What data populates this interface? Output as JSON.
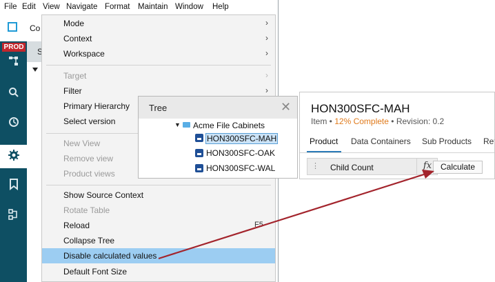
{
  "menubar": [
    "File",
    "Edit",
    "View",
    "Navigate",
    "Format",
    "Maintain",
    "Window",
    "Help"
  ],
  "app": {
    "title_fragment": "Co",
    "env_badge": "PROD",
    "tab_fragment": "S"
  },
  "left_icons": [
    "hierarchy-icon",
    "search-icon",
    "history-icon",
    "gear-icon",
    "bookmark-icon",
    "workflow-icon"
  ],
  "context_menu": {
    "group1": [
      {
        "label": "Mode",
        "submenu": true
      },
      {
        "label": "Context",
        "submenu": true
      },
      {
        "label": "Workspace",
        "submenu": true
      }
    ],
    "group2": [
      {
        "label": "Target",
        "submenu": true,
        "disabled": true
      },
      {
        "label": "Filter",
        "submenu": true
      },
      {
        "label": "Primary Hierarchy"
      },
      {
        "label": "Select version"
      }
    ],
    "group3": [
      {
        "label": "New View",
        "disabled": true
      },
      {
        "label": "Remove view",
        "disabled": true
      },
      {
        "label": "Product views",
        "disabled": true
      }
    ],
    "group4": [
      {
        "label": "Show Source Context"
      },
      {
        "label": "Rotate Table",
        "disabled": true
      },
      {
        "label": "Reload",
        "shortcut": "F5"
      },
      {
        "label": "Collapse Tree"
      },
      {
        "label": "Disable calculated values",
        "highlighted": true
      },
      {
        "label": "Default Font Size"
      }
    ]
  },
  "tree": {
    "title": "Tree",
    "root": "Acme File Cabinets",
    "items": [
      "HON300SFC-MAH",
      "HON300SFC-OAK",
      "HON300SFC-WAL"
    ],
    "selected": "HON300SFC-MAH"
  },
  "item_panel": {
    "title": "HON300SFC-MAH",
    "subtitle_type": "Item",
    "subtitle_complete": "12% Complete",
    "subtitle_revision": "Revision: 0.2",
    "tabs": [
      "Product",
      "Data Containers",
      "Sub Products",
      "Ref"
    ],
    "active_tab": "Product",
    "row_name": "Child Count",
    "fx_label": "fx",
    "calc_button": "Calculate"
  },
  "colors": {
    "sidebar": "#0e4f63",
    "highlight": "#9ccdf2",
    "prod_badge": "#c1272d",
    "complete": "#e07a1b",
    "arrow": "#a3242c"
  }
}
